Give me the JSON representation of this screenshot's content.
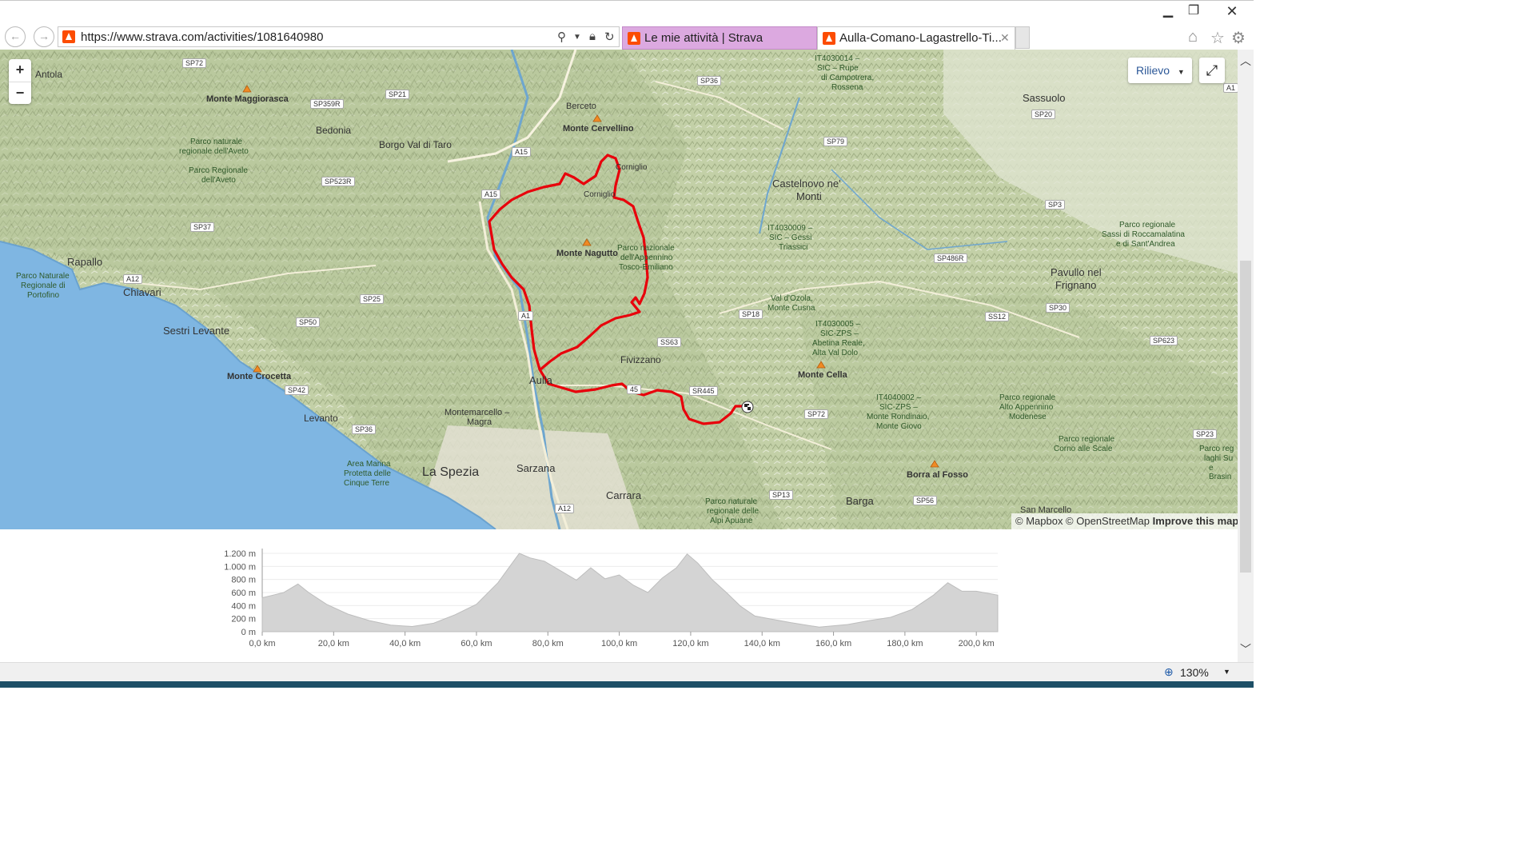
{
  "browser": {
    "url": "https://www.strava.com/activities/1081640980",
    "tabs": [
      {
        "label": "Le mie attività | Strava",
        "color": "#dca9e0",
        "active": false
      },
      {
        "label": "Aulla-Comano-Lagastrello-Ti...",
        "color": "#ffffff",
        "active": true
      }
    ],
    "window_buttons": [
      "minimize",
      "maximize",
      "close"
    ],
    "icons": [
      "back-icon",
      "forward-icon",
      "search-icon",
      "lock-icon",
      "refresh-icon",
      "home-icon",
      "favorites-star-icon",
      "settings-gear-icon"
    ]
  },
  "map": {
    "zoom_in": "+",
    "zoom_out": "−",
    "layer_label": "Rilievo",
    "attribution_prefix": "© Mapbox © OpenStreetMap",
    "attribution_link": "Improve this map",
    "route_color": "#e8000b",
    "labels": {
      "antola": "Antola",
      "monte_maggiorasca": "Monte Maggiorasca",
      "bedonia": "Bedonia",
      "borgo_val_di_taro": "Borgo Val di Taro",
      "berceto": "Berceto",
      "monte_cervellino": "Monte Cervellino",
      "parco_aveto_1": "Parco naturale",
      "parco_aveto_2": "regionale dell'Aveto",
      "parco_aveto_3": "Parco Regionale",
      "parco_aveto_4": "dell'Aveto",
      "corniglio_1": "Corniglio",
      "corniglio_2": "Corniglio",
      "castelnovo_1": "Castelnovo ne'",
      "castelnovo_2": "Monti",
      "sassuolo": "Sassuolo",
      "it4030014_1": "IT4030014 –",
      "it4030014_2": "SIC – Rupe",
      "it4030014_3": "di Campotrera,",
      "it4030014_4": "Rossena",
      "rapallo": "Rapallo",
      "portofino_1": "Parco Naturale",
      "portofino_2": "Regionale di",
      "portofino_3": "Portofino",
      "chiavari": "Chiavari",
      "monte_nagutto": "Monte Nagutto",
      "parco_app_1": "Parco nazionale",
      "parco_app_2": "dell'Appennino",
      "parco_app_3": "Tosco-Emiliano",
      "it4030009_1": "IT4030009 –",
      "it4030009_2": "SIC – Gessi",
      "it4030009_3": "Triassici",
      "sassi_1": "Parco regionale",
      "sassi_2": "Sassi di Roccamalatina",
      "sassi_3": "e di Sant'Andrea",
      "pavullo_1": "Pavullo nel",
      "pavullo_2": "Frignano",
      "sestri_levante": "Sestri Levante",
      "val_dozola_1": "Val d'Ozola,",
      "val_dozola_2": "Monte Cusna",
      "it4030005_1": "IT4030005 –",
      "it4030005_2": "SIC-ZPS –",
      "it4030005_3": "Abetina Reale,",
      "it4030005_4": "Alta Val Dolo",
      "fivizzano": "Fivizzano",
      "monte_cella": "Monte Cella",
      "monte_crocetta": "Monte Crocetta",
      "aulla": "Aulla",
      "montemarcello_1": "Montemarcello –",
      "montemarcello_2": "Magra",
      "levanto": "Levanto",
      "it4040002_1": "IT4040002 –",
      "it4040002_2": "SIC-ZPS –",
      "it4040002_3": "Monte Rondinaio,",
      "it4040002_4": "Monte Giovo",
      "alto_app_1": "Parco regionale",
      "alto_app_2": "Alto Appennino",
      "alto_app_3": "Modenese",
      "corno_1": "Parco regionale",
      "corno_2": "Corno alle Scale",
      "cinque_terre_1": "Area Marina",
      "cinque_terre_2": "Protetta delle",
      "cinque_terre_3": "Cinque Terre",
      "la_spezia": "La Spezia",
      "sarzana": "Sarzana",
      "carrara": "Carrara",
      "alpi_apuane_1": "Parco naturale",
      "alpi_apuane_2": "regionale delle",
      "alpi_apuane_3": "Alpi Apuane",
      "barga": "Barga",
      "borra_al_fosso": "Borra al Fosso",
      "san_marcello": "San Marcello",
      "laghi_su_1": "Parco reg",
      "laghi_su_2": "laghi Su",
      "laghi_su_3": "e Brasin"
    },
    "road_shields": {
      "sp72_a": "SP72",
      "sp21": "SP21",
      "sp36_a": "SP36",
      "a15_a": "A15",
      "sp359r": "SP359R",
      "sp523r": "SP523R",
      "a15_b": "A15",
      "sp79": "SP79",
      "sp20": "SP20",
      "sp37": "SP37",
      "sp3": "SP3",
      "sp486r": "SP486R",
      "a12_a": "A12",
      "sp25": "SP25",
      "sp50": "SP50",
      "a15_c": "A1",
      "sp18": "SP18",
      "ss12": "SS12",
      "sp30": "SP30",
      "ss63": "SS63",
      "sp623": "SP623",
      "sr445_a": "SR445",
      "sr445_b": "45",
      "sp42": "SP42",
      "sp72_b": "SP72",
      "sp36_b": "SP36",
      "sp23": "SP23",
      "sp13": "SP13",
      "sp56": "SP56",
      "a12_b": "A12",
      "a1_edge": "A1",
      "a1_top": "1"
    }
  },
  "elevation": {
    "y_ticks": [
      "1.200 m",
      "1.000 m",
      "800 m",
      "600 m",
      "400 m",
      "200 m",
      "0 m"
    ],
    "x_ticks": [
      "0,0 km",
      "20,0 km",
      "40,0 km",
      "60,0 km",
      "80,0 km",
      "100,0 km",
      "120,0 km",
      "140,0 km",
      "160,0 km",
      "180,0 km",
      "200,0 km"
    ],
    "fill_color": "#d4d4d4",
    "profile_km": [
      0,
      3,
      6,
      10,
      13,
      18,
      24,
      30,
      36,
      42,
      48,
      54,
      60,
      66,
      70,
      72,
      75,
      79,
      84,
      88,
      92,
      96,
      100,
      104,
      108,
      112,
      116,
      119,
      122,
      126,
      130,
      134,
      138,
      142,
      148,
      156,
      164,
      170,
      176,
      182,
      188,
      192,
      196,
      200,
      204,
      206
    ],
    "profile_m": [
      520,
      560,
      600,
      730,
      600,
      420,
      270,
      170,
      100,
      80,
      130,
      260,
      420,
      750,
      1050,
      1200,
      1130,
      1080,
      920,
      790,
      980,
      810,
      870,
      710,
      600,
      820,
      980,
      1190,
      1050,
      800,
      600,
      390,
      240,
      200,
      140,
      70,
      110,
      170,
      220,
      340,
      560,
      750,
      620,
      620,
      580,
      560
    ]
  },
  "status_bar": {
    "zoom_level": "130%"
  }
}
